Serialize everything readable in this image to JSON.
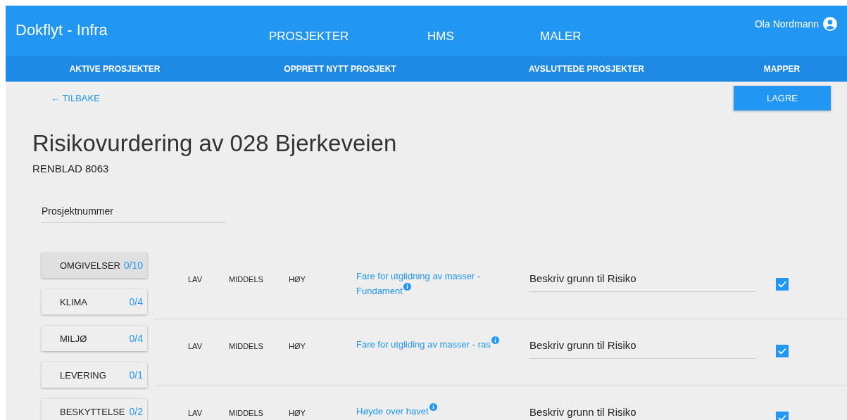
{
  "app": {
    "title": "Dokflyt - Infra",
    "user": "Ola Nordmann"
  },
  "main_nav": [
    {
      "label": "PROSJEKTER"
    },
    {
      "label": "HMS"
    },
    {
      "label": "MALER"
    }
  ],
  "sub_nav": [
    {
      "label": "AKTIVE PROSJEKTER"
    },
    {
      "label": "OPPRETT NYTT PROSJEKT"
    },
    {
      "label": "AVSLUTTEDE PROSJEKTER"
    },
    {
      "label": "MAPPER"
    }
  ],
  "back_link": "← TILBAKE",
  "save_button": "LAGRE",
  "page": {
    "title": "Risikovurdering av 028 Bjerkeveien",
    "subtitle": "RENBLAD 8063"
  },
  "project_number_field": {
    "placeholder": "Prosjektnummer"
  },
  "categories": [
    {
      "name": "OMGIVELSER",
      "count": "0/10",
      "selected": true
    },
    {
      "name": "KLIMA",
      "count": "0/4",
      "selected": false
    },
    {
      "name": "MILJØ",
      "count": "0/4",
      "selected": false
    },
    {
      "name": "LEVERING",
      "count": "0/1",
      "selected": false
    },
    {
      "name": "BESKYTTELSE",
      "count": "0/2",
      "selected": false
    }
  ],
  "risks": [
    {
      "levels": [
        "LAV",
        "MIDDELS",
        "HØY"
      ],
      "title": "Fare for utglidning av masser - Fundament",
      "reason": "Beskriv grunn til Risiko",
      "checked": true
    },
    {
      "levels": [
        "LAV",
        "MIDDELS",
        "HØY"
      ],
      "title": "Fare for utgliding av masser - ras",
      "reason": "Beskriv grunn til Risiko",
      "checked": true
    },
    {
      "levels": [
        "LAV",
        "MIDDELS",
        "HØY"
      ],
      "title": "Høyde over havet",
      "reason": "Beskriv grunn til Risiko",
      "checked": true
    }
  ]
}
